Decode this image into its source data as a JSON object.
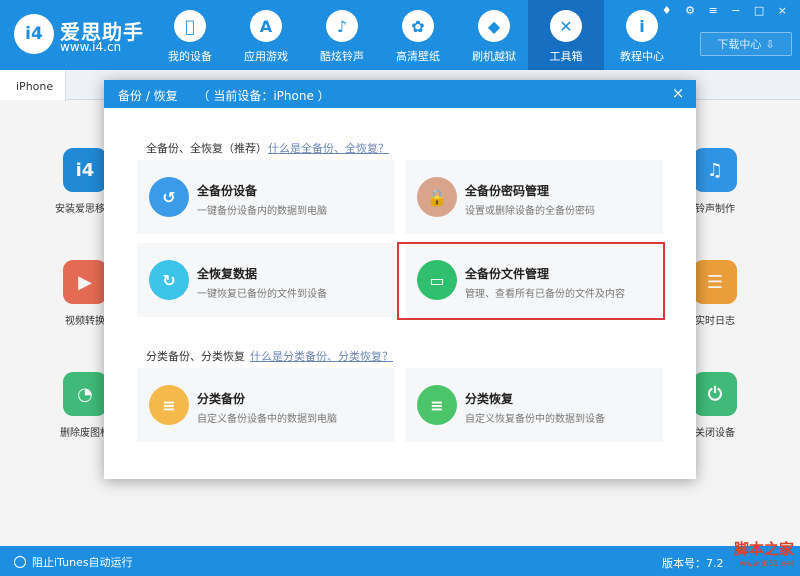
{
  "app": {
    "brand_name": "爱思助手",
    "brand_url": "www.i4.cn",
    "logo_text": "i4",
    "nav": [
      {
        "label": "我的设备",
        "icon": "apple-icon",
        "glyph": ""
      },
      {
        "label": "应用游戏",
        "icon": "app-store-icon",
        "glyph": "A"
      },
      {
        "label": "酷炫铃声",
        "icon": "bell-icon",
        "glyph": "♪"
      },
      {
        "label": "高清壁纸",
        "icon": "flower-icon",
        "glyph": "✿"
      },
      {
        "label": "刷机越狱",
        "icon": "box-icon",
        "glyph": "◆"
      },
      {
        "label": "工具箱",
        "icon": "tools-icon",
        "glyph": "✕"
      },
      {
        "label": "教程中心",
        "icon": "info-icon",
        "glyph": "i"
      }
    ],
    "active_nav": "工具箱",
    "download_center": "下载中心",
    "window_controls": "♦ ⚙ ≡ − □ ×"
  },
  "tabs": {
    "device_tab": "iPhone"
  },
  "background_tools": [
    {
      "label": "安装爱思移动",
      "icon": "i4-mobile-icon",
      "glyph": "i4",
      "color": "#1e8ee0"
    },
    {
      "label": "视频转换",
      "icon": "video-convert-icon",
      "glyph": "▶",
      "color": "#ef6e54"
    },
    {
      "label": "删除废图标",
      "icon": "delete-icon-icon",
      "glyph": "◔",
      "color": "#3fc27c"
    },
    {
      "label": "铃声制作",
      "icon": "bell-make-icon",
      "glyph": "♫",
      "color": "#2f99ee"
    },
    {
      "label": "实时日志",
      "icon": "log-icon",
      "glyph": "☰",
      "color": "#f4a43a"
    },
    {
      "label": "关闭设备",
      "icon": "power-icon",
      "glyph": "⏻",
      "color": "#3fc27c"
    }
  ],
  "dialog": {
    "title": "备份 / 恢复",
    "title_extra": "（ 当前设备：iPhone ）",
    "close": "×",
    "section1": {
      "title": "全备份、全恢复（推荐）",
      "link": "什么是全备份、全恢复？"
    },
    "section2": {
      "title": "分类备份、分类恢复",
      "link": "什么是分类备份、分类恢复？"
    },
    "cards": [
      {
        "title": "全备份设备",
        "desc": "一键备份设备内的数据到电脑",
        "icon": "backup-icon",
        "glyph": "↺",
        "color": "#3b9be8"
      },
      {
        "title": "全备份密码管理",
        "desc": "设置或删除设备的全备份密码",
        "icon": "lock-icon",
        "glyph": "🔒",
        "color": "#d8a48c"
      },
      {
        "title": "全恢复数据",
        "desc": "一键恢复已备份的文件到设备",
        "icon": "restore-icon",
        "glyph": "↻",
        "color": "#3cc4e8"
      },
      {
        "title": "全备份文件管理",
        "desc": "管理、查看所有已备份的文件及内容",
        "icon": "folder-icon",
        "glyph": "▭",
        "color": "#2fbf6e"
      },
      {
        "title": "分类备份",
        "desc": "自定义备份设备中的数据到电脑",
        "icon": "category-backup-icon",
        "glyph": "≡",
        "color": "#f5b84a"
      },
      {
        "title": "分类恢复",
        "desc": "自定义恢复备份中的数据到设备",
        "icon": "category-restore-icon",
        "glyph": "≡",
        "color": "#4cc46a"
      }
    ]
  },
  "statusbar": {
    "itunes_label": "阻止iTunes自动运行",
    "version": "版本号：7.2"
  },
  "watermark": {
    "main": "脚本之家",
    "sub": "www.jb51.net"
  }
}
